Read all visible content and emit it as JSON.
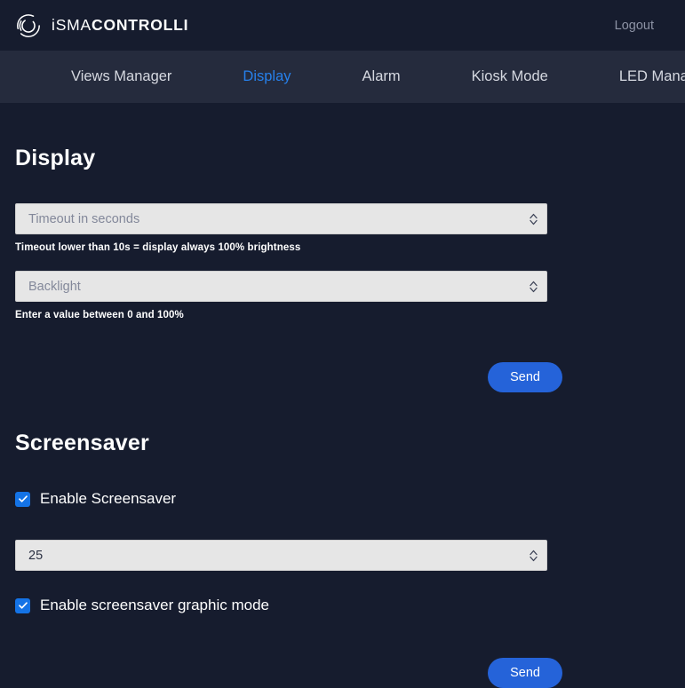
{
  "header": {
    "brand_light": "iSMA",
    "brand_bold": "CONTROLLI",
    "logo_icon": "isma-circle-logo-icon",
    "logout_label": "Logout"
  },
  "nav": {
    "items": [
      {
        "label": "Views Manager",
        "active": false
      },
      {
        "label": "Display",
        "active": true
      },
      {
        "label": "Alarm",
        "active": false
      },
      {
        "label": "Kiosk Mode",
        "active": false
      },
      {
        "label": "LED Manager",
        "active": false
      }
    ],
    "active_color": "#2680eb"
  },
  "display_section": {
    "title": "Display",
    "timeout_field": {
      "placeholder": "Timeout in seconds",
      "value": "",
      "helper": "Timeout lower than 10s = display always 100% brightness",
      "spinner_icon": "stepper-updown-icon"
    },
    "backlight_field": {
      "placeholder": "Backlight",
      "value": "",
      "helper": "Enter a value between 0 and 100%",
      "spinner_icon": "stepper-updown-icon"
    },
    "send_label": "Send"
  },
  "screensaver_section": {
    "title": "Screensaver",
    "enable_checkbox": {
      "label": "Enable Screensaver",
      "checked": true,
      "icon": "checkmark-icon"
    },
    "timeout_field": {
      "value": "25",
      "placeholder": "",
      "spinner_icon": "stepper-updown-icon"
    },
    "graphic_checkbox": {
      "label": "Enable screensaver graphic mode",
      "checked": true,
      "icon": "checkmark-icon"
    },
    "send_label": "Send"
  },
  "colors": {
    "page_bg": "#161c2e",
    "nav_bg": "#252b3d",
    "accent_blue": "#2563d9",
    "checkbox_blue": "#1473e6",
    "input_bg": "#e6e6e6"
  }
}
